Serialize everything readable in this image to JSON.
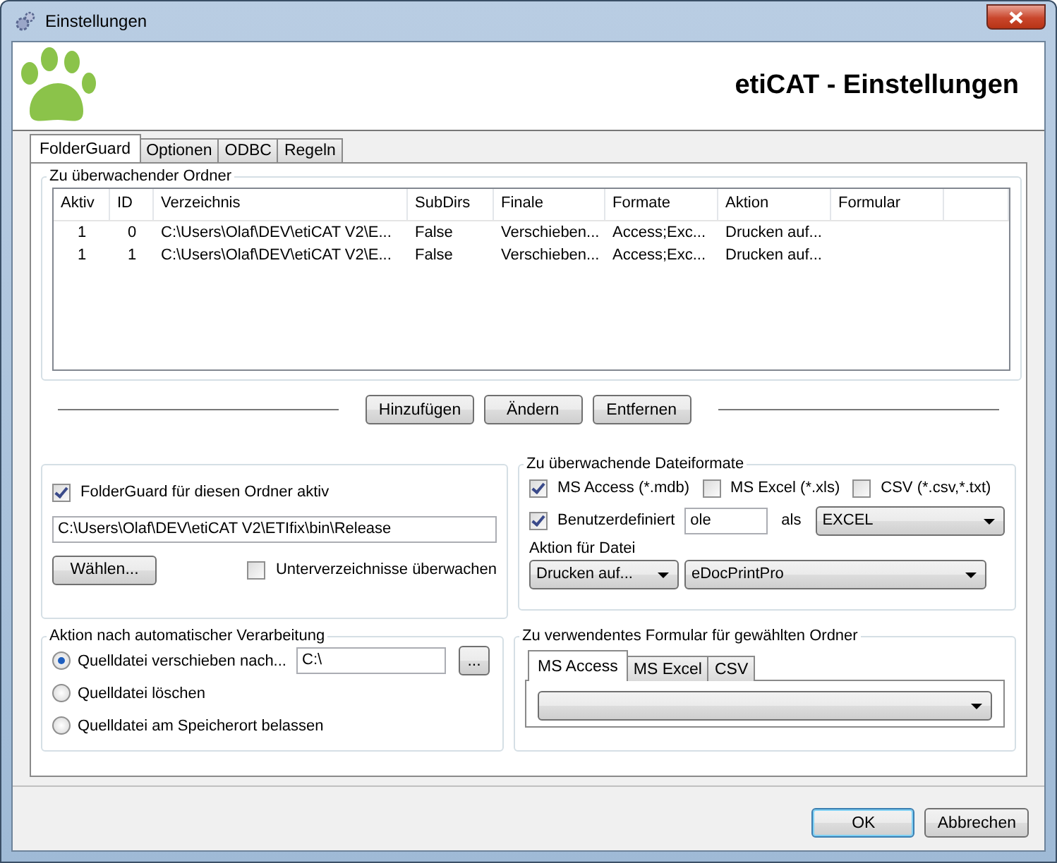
{
  "window": {
    "title": "Einstellungen"
  },
  "header": {
    "title": "etiCAT - Einstellungen"
  },
  "tabs": [
    {
      "label": "FolderGuard",
      "selected": true
    },
    {
      "label": "Optionen",
      "selected": false
    },
    {
      "label": "ODBC",
      "selected": false
    },
    {
      "label": "Regeln",
      "selected": false
    }
  ],
  "watched_folders": {
    "title": "Zu überwachender Ordner",
    "columns": [
      "Aktiv",
      "ID",
      "Verzeichnis",
      "SubDirs",
      "Finale",
      "Formate",
      "Aktion",
      "Formular"
    ],
    "rows": [
      [
        "1",
        "0",
        "C:\\Users\\Olaf\\DEV\\etiCAT V2\\E...",
        "False",
        "Verschieben...",
        "Access;Exc...",
        "Drucken auf..."
      ],
      [
        "1",
        "1",
        "C:\\Users\\Olaf\\DEV\\etiCAT V2\\E...",
        "False",
        "Verschieben...",
        "Access;Exc...",
        "Drucken auf..."
      ]
    ]
  },
  "list_buttons": [
    "Hinzufügen",
    "Ändern",
    "Entfernen"
  ],
  "folder_settings": {
    "active": {
      "label": "FolderGuard für diesen Ordner aktiv",
      "checked": true
    },
    "path": "C:\\Users\\Olaf\\DEV\\etiCAT V2\\ETIfix\\bin\\Release",
    "choose_button": "Wählen...",
    "subdirs": {
      "label": "Unterverzeichnisse überwachen",
      "checked": false
    }
  },
  "formats": {
    "title": "Zu überwachende Dateiformate",
    "options": [
      {
        "label": "MS Access (*.mdb)",
        "checked": true
      },
      {
        "label": "MS Excel (*.xls)",
        "checked": false
      },
      {
        "label": "CSV (*.csv,*.txt)",
        "checked": false
      }
    ],
    "custom": {
      "label": "Benutzerdefiniert",
      "checked": true,
      "value": "ole"
    },
    "as_label": "als",
    "as_value": "EXCEL",
    "action_label": "Aktion für Datei",
    "action_value": "Drucken auf...",
    "printer_value": "eDocPrintPro"
  },
  "after_processing": {
    "title": "Aktion nach automatischer Verarbeitung",
    "options": [
      {
        "label": "Quelldatei verschieben nach...",
        "selected": true
      },
      {
        "label": "Quelldatei löschen",
        "selected": false
      },
      {
        "label": "Quelldatei am Speicherort belassen",
        "selected": false
      }
    ],
    "target": "C:\\",
    "browse_button": "..."
  },
  "form": {
    "title": "Zu verwendentes Formular für gewählten Ordner",
    "tabs": [
      {
        "label": "MS Access",
        "selected": true
      },
      {
        "label": "MS Excel",
        "selected": false
      },
      {
        "label": "CSV",
        "selected": false
      }
    ]
  },
  "dialog_buttons": [
    "OK",
    "Abbrechen"
  ]
}
